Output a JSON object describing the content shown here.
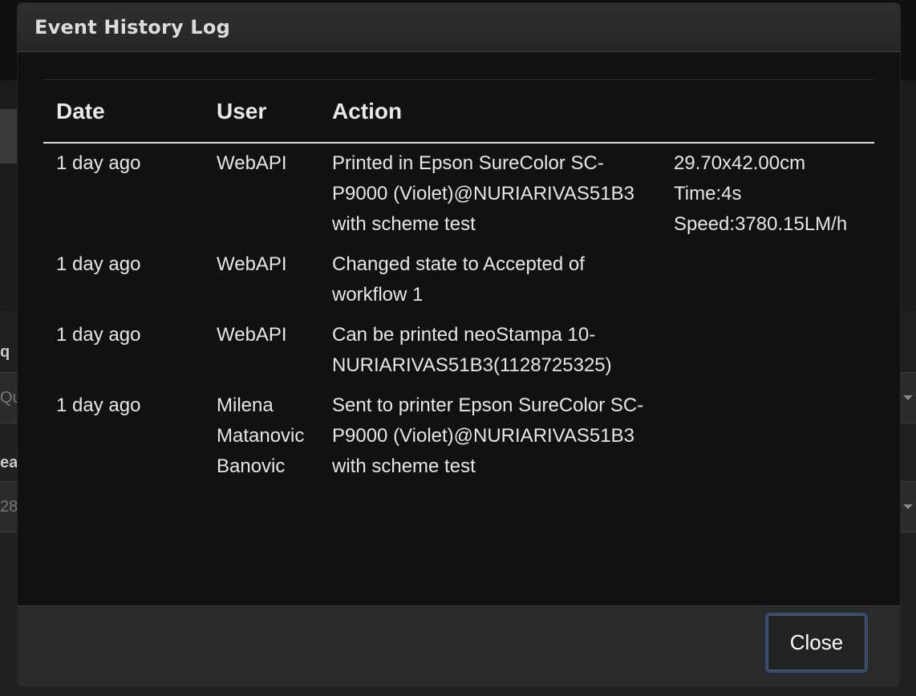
{
  "background": {
    "fragments": [
      "Qu",
      "28"
    ]
  },
  "modal": {
    "title": "Event History Log",
    "table": {
      "headers": {
        "date": "Date",
        "user": "User",
        "action": "Action"
      },
      "rows": [
        {
          "date": "1 day ago",
          "user": "WebAPI",
          "action": "Printed in Epson SureColor SC-P9000 (Violet)@NURIARIVAS51B3 with scheme test",
          "details": [
            "29.70x42.00cm",
            "Time:4s",
            "Speed:3780.15LM/h"
          ]
        },
        {
          "date": "1 day ago",
          "user": "WebAPI",
          "action": "Changed state to Accepted of workflow 1",
          "details": []
        },
        {
          "date": "1 day ago",
          "user": "WebAPI",
          "action": "Can be printed neoStampa 10-NURIARIVAS51B3(1128725325)",
          "details": []
        },
        {
          "date": "1 day ago",
          "user": "Milena Matanovic Banovic",
          "action": "Sent to printer Epson SureColor SC-P9000 (Violet)@NURIARIVAS51B3 with scheme test",
          "details": []
        }
      ]
    },
    "footer": {
      "close_label": "Close"
    }
  },
  "colors": {
    "modal_bg": "#111111",
    "header_bg": "#2b2b2b",
    "footer_bg": "#2a2a2a",
    "button_border": "#2e4f7a",
    "text": "#e6e6e6"
  }
}
